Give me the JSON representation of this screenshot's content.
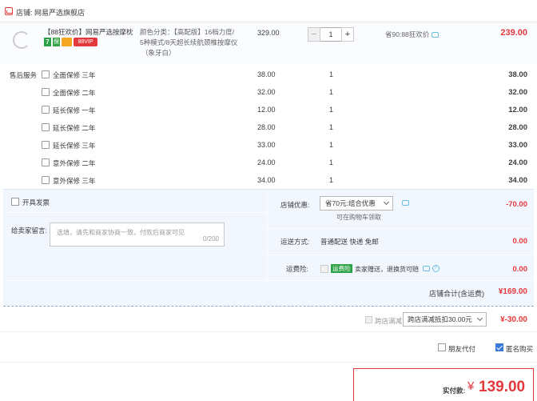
{
  "shop": {
    "label": "店铺: 网易严选旗舰店"
  },
  "product": {
    "title": "【88狂欢价】网易严选按摩枕...",
    "badge_7": "7",
    "badge_shield": "保",
    "badge_88": "88VIP",
    "sku_lines": [
      "颜色分类：【高配版】16档力度/",
      "5种模式/8天超长续航颈椎按摩仪",
      "（象牙白）"
    ],
    "price": "329.00",
    "quantity": "1",
    "qty_minus": "−",
    "qty_plus": "+",
    "discount": "省90:88狂欢价",
    "subtotal": "239.00"
  },
  "services": {
    "label": "售后服务",
    "items": [
      {
        "name": "全面保修 三年",
        "price": "38.00",
        "qty": "1",
        "subtotal": "38.00"
      },
      {
        "name": "全面保修 二年",
        "price": "32.00",
        "qty": "1",
        "subtotal": "32.00"
      },
      {
        "name": "延长保修 一年",
        "price": "12.00",
        "qty": "1",
        "subtotal": "12.00"
      },
      {
        "name": "延长保修 二年",
        "price": "28.00",
        "qty": "1",
        "subtotal": "28.00"
      },
      {
        "name": "延长保修 三年",
        "price": "33.00",
        "qty": "1",
        "subtotal": "33.00"
      },
      {
        "name": "意外保修 二年",
        "price": "24.00",
        "qty": "1",
        "subtotal": "24.00"
      },
      {
        "name": "意外保修 三年",
        "price": "34.00",
        "qty": "1",
        "subtotal": "34.00"
      }
    ]
  },
  "options": {
    "invoice_label": "开具发票",
    "message_label": "给卖家留言:",
    "message_placeholder": "选填，请先和商家协商一致，付款后商家可见",
    "message_count": "0/200",
    "coupon_label": "店铺优惠:",
    "coupon_value": "省70元:组合优惠",
    "coupon_note": "可在购物车领取",
    "coupon_amount": "-70.00",
    "shipping_label": "运送方式:",
    "shipping_value": "普通配送 快递 免邮",
    "shipping_amount": "0.00",
    "insurance_label": "运费险:",
    "insurance_badge": "运费险",
    "insurance_text": "卖家赠送，退换货可赔",
    "insurance_amount": "0.00",
    "q_mark": "?",
    "shop_total_label": "店铺合计(含运费)",
    "shop_total_value": "¥169.00"
  },
  "promo": {
    "label": "跨店满减",
    "select_value": "跨店满减抵扣30.00元",
    "amount": "¥-30.00"
  },
  "extras": {
    "friend_pay": "朋友代付",
    "anonymous": "匿名购买"
  },
  "payment": {
    "label": "实付款:",
    "currency": "¥",
    "amount": "139.00"
  },
  "colors": {
    "accent": "#e4393c",
    "blue": "#3a7ad9",
    "green": "#2ba245"
  }
}
